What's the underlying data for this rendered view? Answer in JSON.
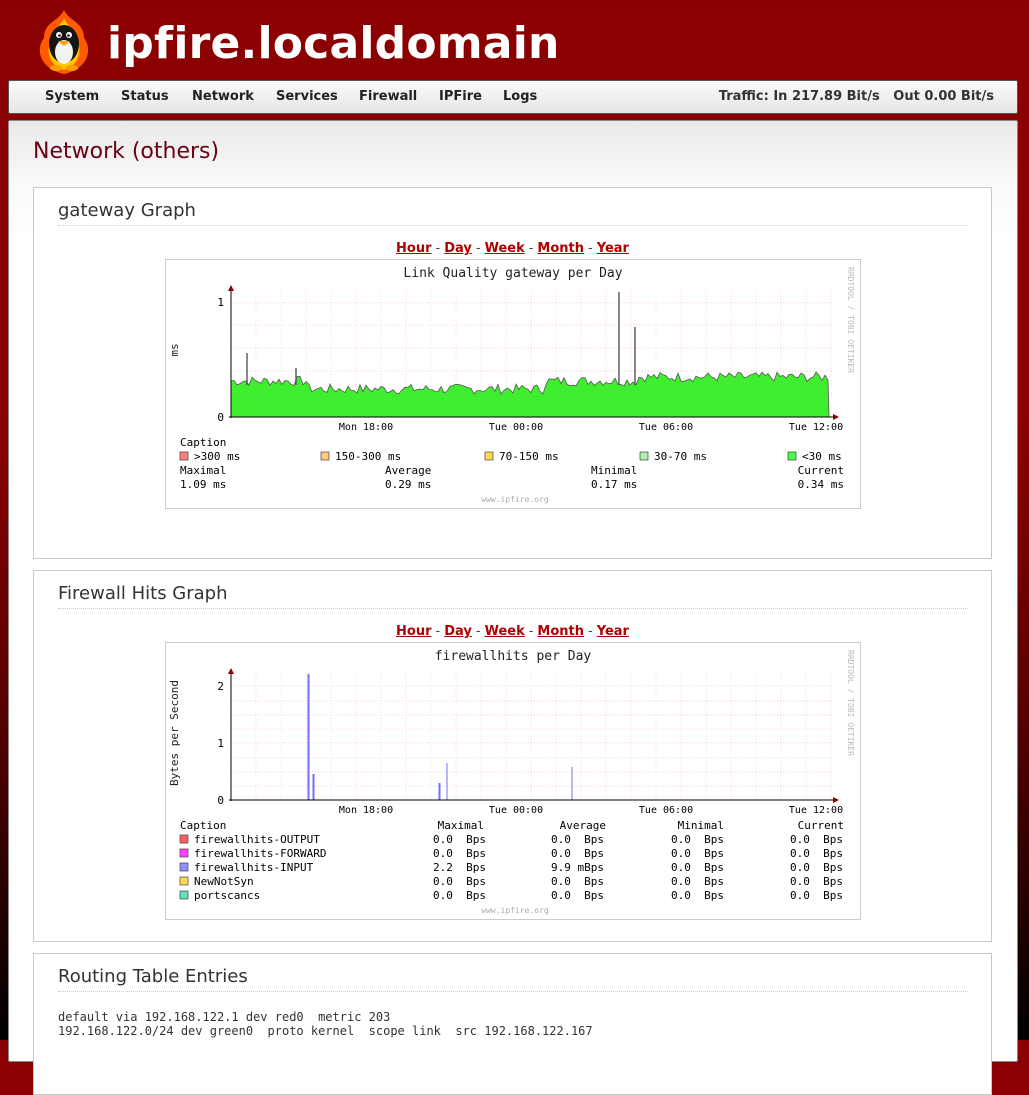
{
  "header": {
    "title": "ipfire.localdomain"
  },
  "nav": {
    "items": [
      "System",
      "Status",
      "Network",
      "Services",
      "Firewall",
      "IPFire",
      "Logs"
    ],
    "traffic": "Traffic: In 217.89 Bit/s   Out 0.00 Bit/s"
  },
  "page": {
    "title": "Network (others)"
  },
  "tabs": [
    "Hour",
    "Day",
    "Week",
    "Month",
    "Year"
  ],
  "gateway": {
    "section_title": "gateway Graph",
    "graph_title": "Link Quality gateway per Day",
    "ylabel": "ms",
    "yticks": [
      "1",
      "0"
    ],
    "xticks": [
      "Mon 18:00",
      "Tue 00:00",
      "Tue 06:00",
      "Tue 12:00"
    ],
    "watermark": "RRDTOOL / TOBI OETIKER",
    "footer": "www.ipfire.org",
    "caption": "Caption",
    "legend": [
      {
        "label": ">300 ms",
        "color": "#ff8080"
      },
      {
        "label": "150-300 ms",
        "color": "#ffc880"
      },
      {
        "label": "70-150 ms",
        "color": "#ffd850"
      },
      {
        "label": "30-70 ms",
        "color": "#b0f0b0"
      },
      {
        "label": "<30 ms",
        "color": "#40ff40"
      }
    ],
    "stats_headers": [
      "Maximal",
      "Average",
      "Minimal",
      "Current"
    ],
    "stats_values": [
      "1.09 ms",
      "0.29 ms",
      "0.17 ms",
      "0.34 ms"
    ]
  },
  "firewall": {
    "section_title": "Firewall Hits Graph",
    "graph_title": "firewallhits per Day",
    "ylabel": "Bytes per Second",
    "yticks": [
      "2",
      "1",
      "0"
    ],
    "xticks": [
      "Mon 18:00",
      "Tue 00:00",
      "Tue 06:00",
      "Tue 12:00"
    ],
    "watermark": "RRDTOOL / TOBI OETIKER",
    "footer": "www.ipfire.org",
    "headers": [
      "Caption",
      "Maximal",
      "Average",
      "Minimal",
      "Current"
    ],
    "rows": [
      {
        "label": "firewallhits-OUTPUT",
        "color": "#ff6060",
        "values": [
          "0.0  Bps",
          "0.0  Bps",
          "0.0  Bps",
          "0.0  Bps"
        ]
      },
      {
        "label": "firewallhits-FORWARD",
        "color": "#ff40ff",
        "values": [
          "0.0  Bps",
          "0.0  Bps",
          "0.0  Bps",
          "0.0  Bps"
        ]
      },
      {
        "label": "firewallhits-INPUT",
        "color": "#9090ff",
        "values": [
          "2.2  Bps",
          "9.9 mBps",
          "0.0  Bps",
          "0.0  Bps"
        ]
      },
      {
        "label": "NewNotSyn",
        "color": "#ffd850",
        "values": [
          "0.0  Bps",
          "0.0  Bps",
          "0.0  Bps",
          "0.0  Bps"
        ]
      },
      {
        "label": "portscancs",
        "color": "#60e0c0",
        "values": [
          "0.0  Bps",
          "0.0  Bps",
          "0.0  Bps",
          "0.0  Bps"
        ]
      }
    ]
  },
  "routing": {
    "section_title": "Routing Table Entries",
    "lines": [
      "default via 192.168.122.1 dev red0  metric 203",
      "192.168.122.0/24 dev green0  proto kernel  scope link  src 192.168.122.167"
    ]
  }
}
